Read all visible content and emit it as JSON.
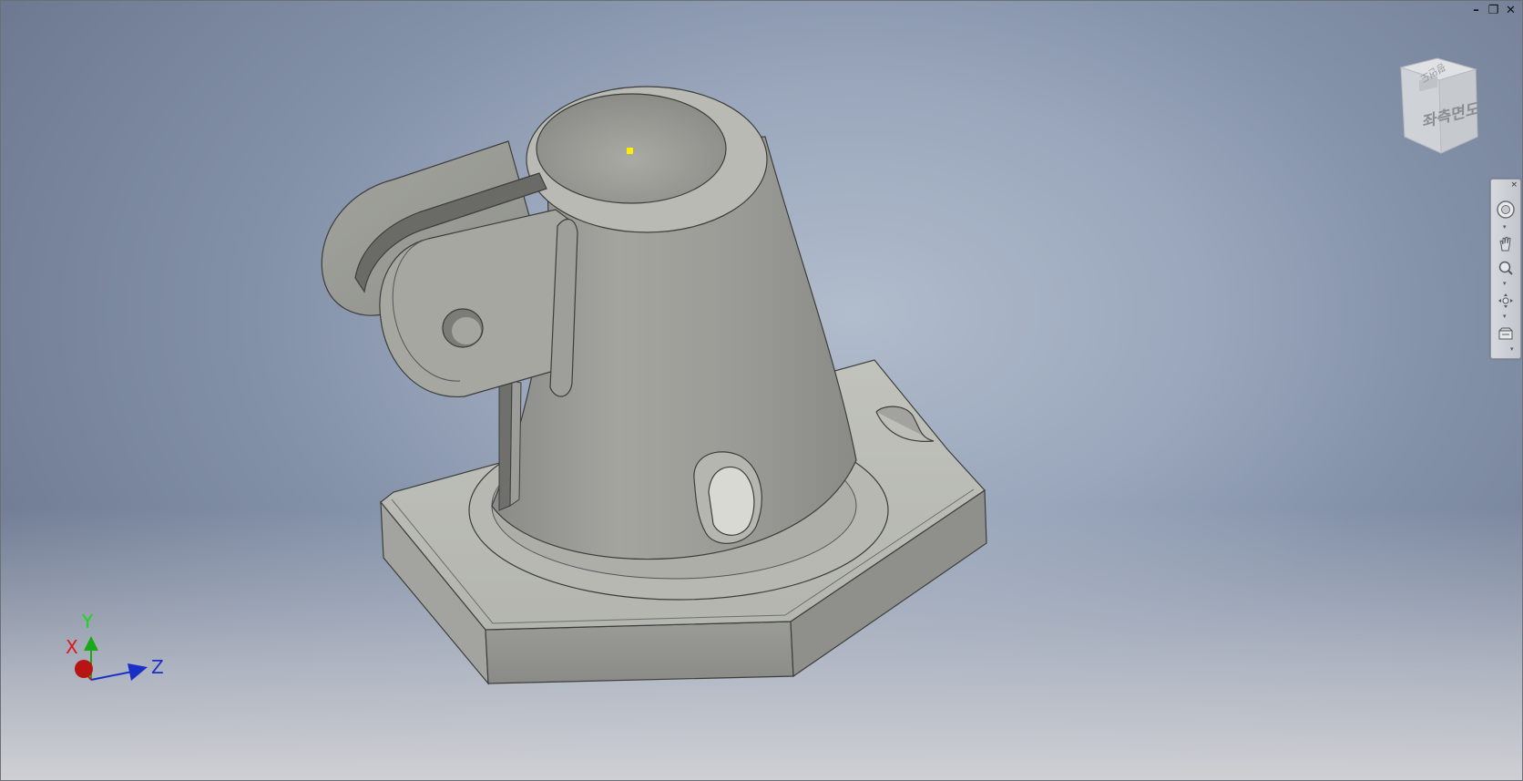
{
  "window": {
    "controls": {
      "minimize": "–",
      "restore": "❐",
      "close": "✕"
    }
  },
  "viewcube": {
    "front_label": "좌측면도",
    "top_label": "평면도"
  },
  "navigation_bar": {
    "close": "×",
    "tools": [
      "steering-wheel-icon",
      "pan-hand-icon",
      "zoom-icon",
      "orbit-icon",
      "look-at-icon"
    ]
  },
  "triad": {
    "x_label": "X",
    "y_label": "Y",
    "z_label": "Z",
    "colors": {
      "x": "#c01818",
      "y": "#18a818",
      "z": "#1a2fc8"
    }
  },
  "model": {
    "name_icon": "pipe-clamp-bracket-part",
    "selection_marker_color": "#ffee00"
  }
}
